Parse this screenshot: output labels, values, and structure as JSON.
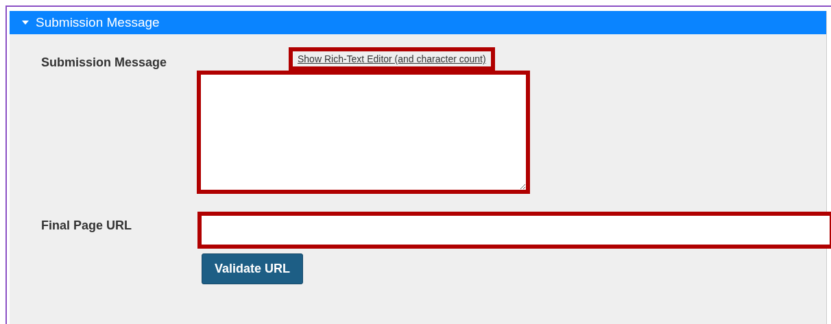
{
  "section": {
    "title": "Submission Message",
    "expanded": true
  },
  "submission_message": {
    "label": "Submission Message",
    "editor_link": "Show Rich-Text Editor (and character count)",
    "editor_link_highlighted": true,
    "highlighted": true
  },
  "final_page_url": {
    "label": "Final Page URL",
    "highlighted": true
  },
  "validate_button": "Validate URL"
}
